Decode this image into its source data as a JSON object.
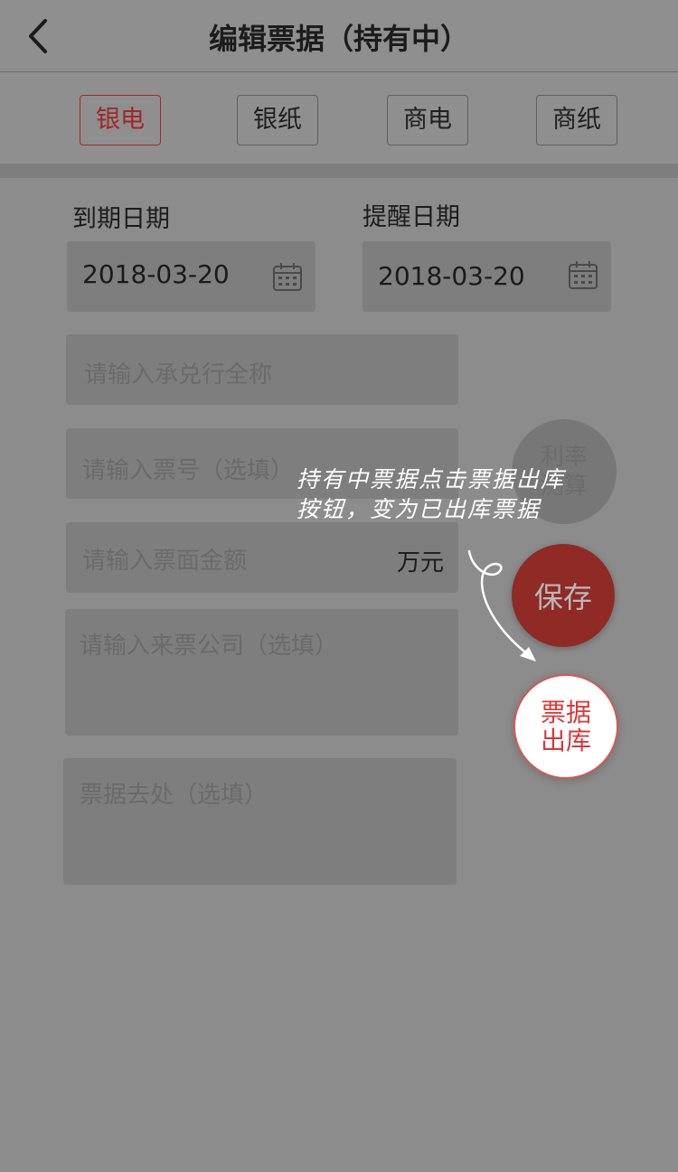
{
  "header": {
    "title": "编辑票据（持有中）",
    "back_icon": "chevron-left-icon"
  },
  "type_tabs": [
    {
      "label": "银电",
      "active": true
    },
    {
      "label": "银纸",
      "active": false
    },
    {
      "label": "商电",
      "active": false
    },
    {
      "label": "商纸",
      "active": false
    }
  ],
  "dates": {
    "due_label": "到期日期",
    "due_value": "2018-03-20",
    "remind_label": "提醒日期",
    "remind_value": "2018-03-20",
    "icon": "calendar-icon"
  },
  "form": {
    "bank_placeholder": "请输入承兑行全称",
    "number_placeholder": "请输入票号（选填）",
    "amount_placeholder": "请输入票面金额",
    "amount_unit": "万元",
    "company_placeholder": "请输入来票公司（选填）",
    "destination_placeholder": "票据去处（选填）"
  },
  "actions": {
    "rate_label": "利率测算",
    "save_label": "保存",
    "out_label": "票据出库"
  },
  "annotation": {
    "text": "持有中票据点击票据出库按钮，变为已出库票据"
  },
  "colors": {
    "accent": "#a3262a",
    "save_bg": "#8f2a26",
    "out_text": "#d93838"
  }
}
